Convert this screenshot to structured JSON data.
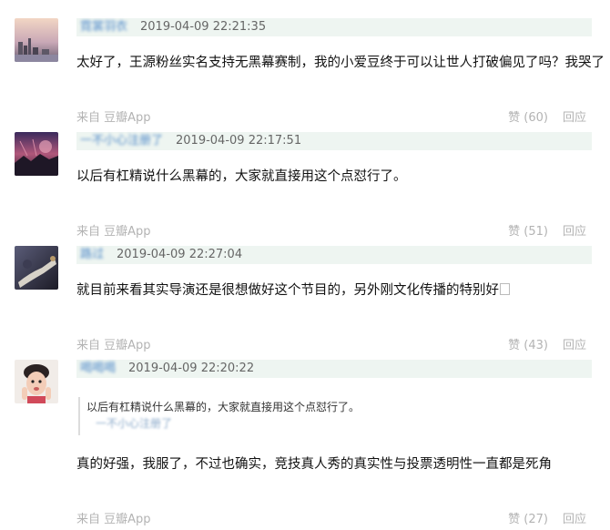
{
  "comments": [
    {
      "author": "霓裳羽衣",
      "time": "2019-04-09 22:21:35",
      "text": "太好了，王源粉丝实名支持无黑幕赛制，我的小爱豆终于可以让世人打破偏见了吗？我哭了",
      "source": "来自 豆瓣App",
      "likes": "赞 (60)",
      "reply": "回应"
    },
    {
      "author": "一不小心注册了",
      "time": "2019-04-09 22:17:51",
      "text": "以后有杠精说什么黑幕的，大家就直接用这个点怼行了。",
      "source": "来自 豆瓣App",
      "likes": "赞 (51)",
      "reply": "回应"
    },
    {
      "author": "路过",
      "time": "2019-04-09 22:27:04",
      "text": "就目前来看其实导演还是很想做好这个节目的，另外刚文化传播的特别好",
      "source": "来自 豆瓣App",
      "likes": "赞 (43)",
      "reply": "回应"
    },
    {
      "author": "喝喝喝",
      "time": "2019-04-09 22:20:22",
      "quote_text": "以后有杠精说什么黑幕的，大家就直接用这个点怼行了。",
      "quote_author": "一不小心注册了",
      "text": "真的好强，我服了，不过也确实，竞技真人秀的真实性与投票透明性一直都是死角",
      "source": "来自 豆瓣App",
      "likes": "赞 (27)",
      "reply": "回应"
    }
  ]
}
